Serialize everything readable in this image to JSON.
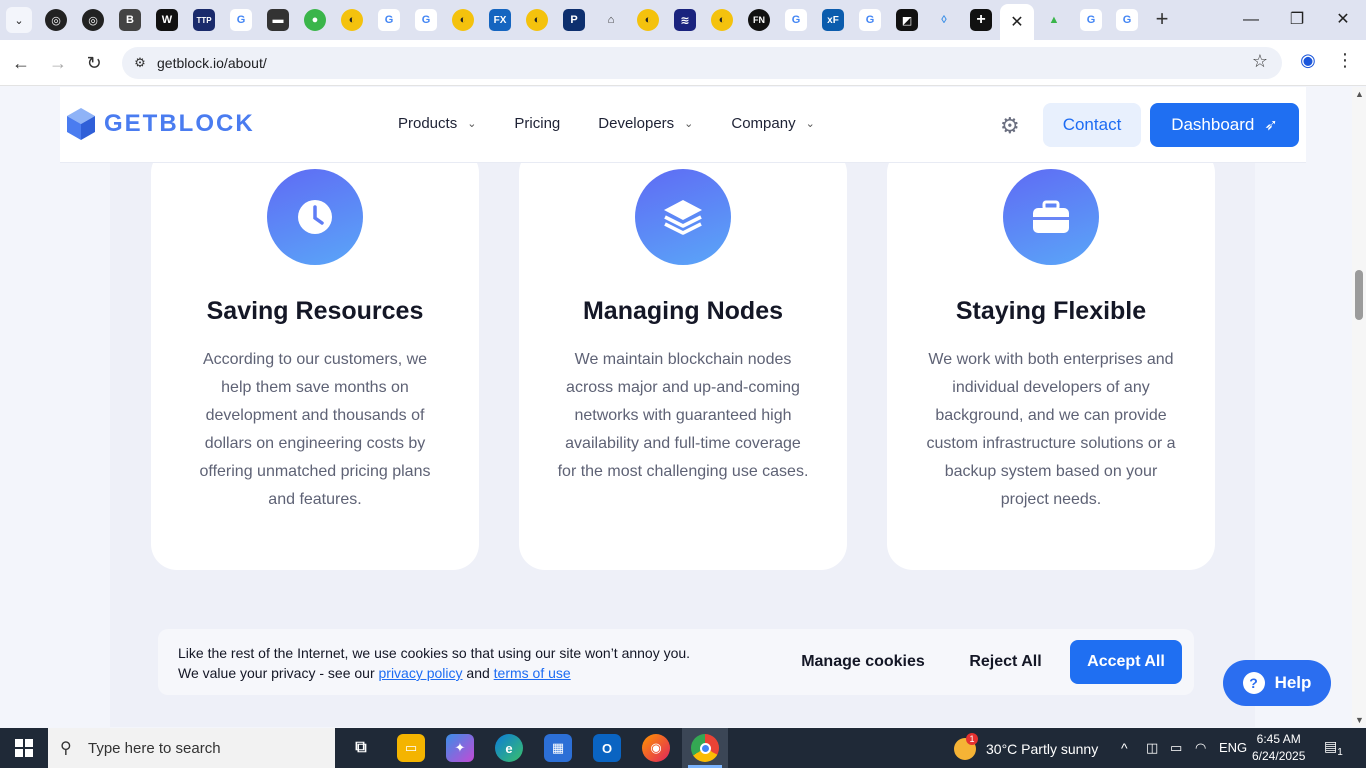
{
  "browser": {
    "url": "getblock.io/about/",
    "active_tab_close": "✕",
    "new_tab": "+",
    "minimize": "—",
    "restore": "❐",
    "close": "✕"
  },
  "header": {
    "logo_text": "GETBLOCK",
    "nav": [
      {
        "label": "Products",
        "has_dropdown": true
      },
      {
        "label": "Pricing",
        "has_dropdown": false
      },
      {
        "label": "Developers",
        "has_dropdown": true
      },
      {
        "label": "Company",
        "has_dropdown": true
      }
    ],
    "contact_label": "Contact",
    "dashboard_label": "Dashboard"
  },
  "cards": [
    {
      "icon": "clock-icon",
      "title": "Saving Resources",
      "description": "According to our customers, we help them save months on development and thousands of dollars on engineering costs by offering unmatched pricing plans and features."
    },
    {
      "icon": "layers-icon",
      "title": "Managing Nodes",
      "description": "We maintain blockchain nodes across major and up-and-coming networks with guaranteed high availability and full-time coverage for the most challenging use cases."
    },
    {
      "icon": "briefcase-icon",
      "title": "Staying Flexible",
      "description": "We work with both enterprises and individual developers of any background, and we can provide custom infrastructure solutions or a backup system based on your project needs."
    }
  ],
  "cookie": {
    "line1": "Like the rest of the Internet, we use cookies so that using our site won’t annoy you.",
    "line2_prefix": "We value your privacy - see our ",
    "privacy_link": "privacy policy",
    "and": " and ",
    "terms_link": "terms of use",
    "manage_label": "Manage cookies",
    "reject_label": "Reject All",
    "accept_label": "Accept All"
  },
  "help_label": "Help",
  "taskbar": {
    "search_placeholder": "Type here to search",
    "weather": "30°C  Partly sunny",
    "lang": "ENG",
    "time": "6:45 AM",
    "date": "6/24/2025",
    "weather_badge": "1",
    "notif_badge": "1"
  },
  "colors": {
    "accent": "#1f6ff2",
    "logo": "#4a7cf0",
    "icon_gradient_start": "#5f6bf4",
    "icon_gradient_end": "#5aa6f8"
  }
}
